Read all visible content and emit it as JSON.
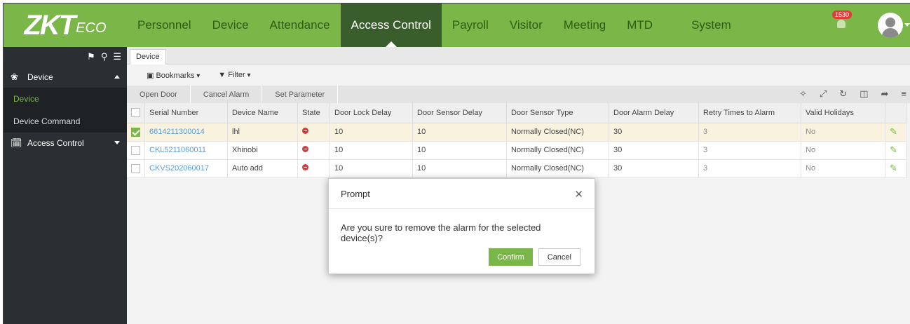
{
  "brand": {
    "logo_main": "ZKT",
    "logo_sub": "ECO"
  },
  "nav": {
    "items": [
      "Personnel",
      "Device",
      "Attendance",
      "Access Control",
      "Payroll",
      "Visitor",
      "Meeting",
      "MTD",
      "System"
    ],
    "active": "Access Control",
    "notification_count": "1530"
  },
  "sidebar": {
    "groups": [
      {
        "label": "Device",
        "icon": "device-group-icon",
        "expanded": true
      },
      {
        "label": "Access Control",
        "icon": "calendar-icon",
        "expanded": false
      }
    ],
    "items": [
      "Device",
      "Device Command"
    ],
    "active_item": "Device"
  },
  "main": {
    "tab": "Device",
    "toolbar": {
      "bookmarks": "Bookmarks",
      "filter": "Filter"
    },
    "actions": [
      "Open Door",
      "Cancel Alarm",
      "Set Parameter"
    ],
    "table": {
      "columns": [
        "Serial Number",
        "Device Name",
        "State",
        "Door Lock Delay",
        "Door Sensor Delay",
        "Door Sensor Type",
        "Door Alarm Delay",
        "Retry Times to Alarm",
        "Valid Holidays"
      ],
      "rows": [
        {
          "serial": "6614211300014",
          "name": "lhl",
          "lock": "10",
          "sensor_delay": "10",
          "sensor_type": "Normally Closed(NC)",
          "alarm_delay": "30",
          "retry": "3",
          "holidays": "No",
          "checked": true
        },
        {
          "serial": "CKL5211060011",
          "name": "Xhinobi",
          "lock": "10",
          "sensor_delay": "10",
          "sensor_type": "Normally Closed(NC)",
          "alarm_delay": "30",
          "retry": "3",
          "holidays": "No",
          "checked": false
        },
        {
          "serial": "CKVS202060017",
          "name": "Auto add",
          "lock": "10",
          "sensor_delay": "10",
          "sensor_type": "Normally Closed(NC)",
          "alarm_delay": "30",
          "retry": "3",
          "holidays": "No",
          "checked": false
        }
      ]
    }
  },
  "dialog": {
    "title": "Prompt",
    "message": "Are you sure to remove the alarm for the selected device(s)?",
    "confirm": "Confirm",
    "cancel": "Cancel"
  },
  "colors": {
    "accent": "#7ab648",
    "nav_active": "#3a5e2b",
    "sidebar": "#2b2f33",
    "link": "#5b9bd5",
    "alert": "#d93a3a"
  }
}
